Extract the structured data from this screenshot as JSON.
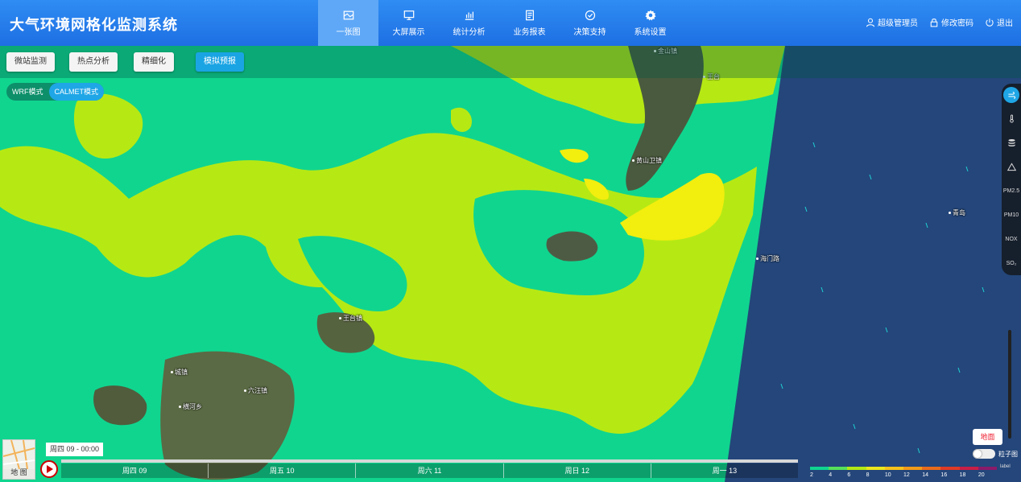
{
  "app_title": "大气环境网格化监测系统",
  "nav": [
    {
      "label": "一张图",
      "icon": "map-icon",
      "active": true
    },
    {
      "label": "大屏展示",
      "icon": "monitor-icon",
      "active": false
    },
    {
      "label": "统计分析",
      "icon": "bar-chart-icon",
      "active": false
    },
    {
      "label": "业务报表",
      "icon": "report-icon",
      "active": false
    },
    {
      "label": "决策支持",
      "icon": "check-circle-icon",
      "active": false
    },
    {
      "label": "系统设置",
      "icon": "gear-icon",
      "active": false
    }
  ],
  "user": {
    "name": "超级管理员",
    "change_password": "修改密码",
    "logout": "退出"
  },
  "toolbar": {
    "buttons": [
      "微站监测",
      "热点分析",
      "精细化",
      "模拟预报"
    ],
    "active": "模拟预报"
  },
  "mode": {
    "options": [
      "WRF模式",
      "CALMET模式"
    ],
    "active": "CALMET模式"
  },
  "rail": [
    {
      "icon": "wind-icon",
      "label": ""
    },
    {
      "icon": "thermometer-icon",
      "label": ""
    },
    {
      "icon": "layers-icon",
      "label": ""
    },
    {
      "icon": "triangle-icon",
      "label": ""
    },
    {
      "icon": "pm25-icon",
      "label": "PM2.5"
    },
    {
      "icon": "pm10-icon",
      "label": "PM10"
    },
    {
      "icon": "nox-icon",
      "label": "NOX"
    },
    {
      "icon": "so2-icon",
      "label": "SO₂"
    }
  ],
  "places": [
    {
      "name": "金山镇"
    },
    {
      "name": "王台"
    },
    {
      "name": "黄山卫镇"
    },
    {
      "name": "王台镇"
    },
    {
      "name": "六汪镇"
    },
    {
      "name": "横河乡"
    },
    {
      "name": "城镇"
    },
    {
      "name": "青岛"
    },
    {
      "name": "海门路"
    }
  ],
  "map_tip": "地面",
  "particle_label": "粒子图",
  "thumbnail_label": "地 图",
  "current_time": "周四 09 - 00:00",
  "timeline": {
    "days": [
      "周四 09",
      "周五 10",
      "周六 11",
      "周日 12",
      "周一 13"
    ],
    "progress": 0.0
  },
  "legend": {
    "ticks": [
      "2",
      "4",
      "6",
      "8",
      "10",
      "12",
      "14",
      "16",
      "18",
      "20"
    ],
    "colors": [
      "#10d58f",
      "#56e05a",
      "#b4e914",
      "#ece61d",
      "#f7c21c",
      "#f29a19",
      "#ea6b1c",
      "#e03a25",
      "#c81e46",
      "#8a1a6a"
    ],
    "unit": "label"
  },
  "colors": {
    "header": "#2f8df3",
    "accent": "#1aa4e4",
    "field_green": "#10d58f",
    "field_lime": "#b6e914",
    "field_yellow": "#f2ee0e",
    "sea": "#1f3a66"
  }
}
